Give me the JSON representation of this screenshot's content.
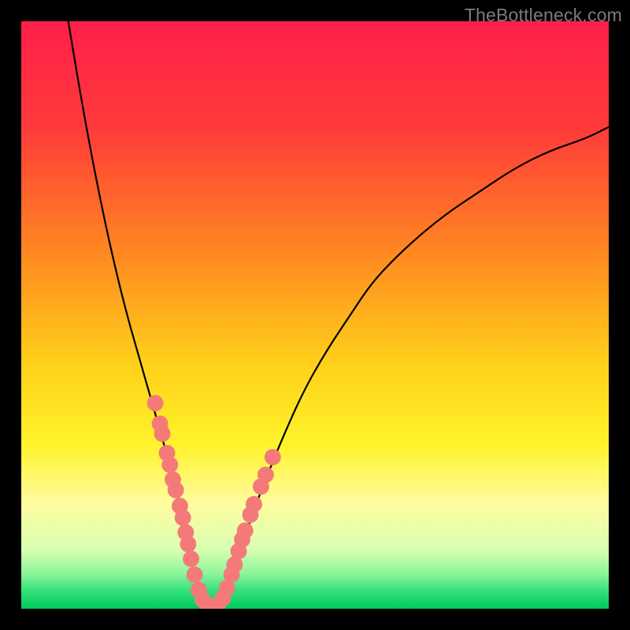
{
  "watermark": "TheBottleneck.com",
  "chart_data": {
    "type": "line",
    "title": "",
    "xlabel": "",
    "ylabel": "",
    "xlim": [
      0,
      100
    ],
    "ylim": [
      0,
      100
    ],
    "grid": false,
    "gradient_stops": [
      {
        "offset": 0.0,
        "color": "#ff1f4a"
      },
      {
        "offset": 0.18,
        "color": "#ff3a3a"
      },
      {
        "offset": 0.4,
        "color": "#ff8a20"
      },
      {
        "offset": 0.58,
        "color": "#ffcf1a"
      },
      {
        "offset": 0.72,
        "color": "#fff32a"
      },
      {
        "offset": 0.82,
        "color": "#fffca0"
      },
      {
        "offset": 0.9,
        "color": "#d9ffb0"
      },
      {
        "offset": 0.94,
        "color": "#8cf59a"
      },
      {
        "offset": 0.97,
        "color": "#33e07a"
      },
      {
        "offset": 1.0,
        "color": "#00c95a"
      }
    ],
    "series": [
      {
        "name": "left-branch",
        "x": [
          8,
          10,
          12,
          14,
          16,
          18,
          20,
          22,
          24,
          26,
          27,
          28,
          29,
          30,
          31
        ],
        "y": [
          100,
          88,
          77,
          67,
          58,
          50,
          43,
          36,
          29,
          22,
          17,
          12,
          8,
          4,
          1
        ]
      },
      {
        "name": "right-branch",
        "x": [
          34,
          36,
          38,
          40,
          44,
          48,
          52,
          56,
          60,
          66,
          72,
          78,
          84,
          90,
          96,
          100
        ],
        "y": [
          1,
          6,
          12,
          18,
          28,
          37,
          44,
          50,
          56,
          62,
          67,
          71,
          75,
          78,
          80,
          82
        ]
      }
    ],
    "trough_beads": {
      "color": "#f47a7a",
      "radius": 1.4,
      "points": [
        {
          "x": 22.8,
          "y": 35.0
        },
        {
          "x": 23.6,
          "y": 31.5
        },
        {
          "x": 24.0,
          "y": 29.8
        },
        {
          "x": 24.8,
          "y": 26.5
        },
        {
          "x": 25.3,
          "y": 24.5
        },
        {
          "x": 25.8,
          "y": 22.0
        },
        {
          "x": 26.3,
          "y": 20.2
        },
        {
          "x": 27.0,
          "y": 17.5
        },
        {
          "x": 27.5,
          "y": 15.5
        },
        {
          "x": 28.0,
          "y": 13.0
        },
        {
          "x": 28.4,
          "y": 11.0
        },
        {
          "x": 28.9,
          "y": 8.5
        },
        {
          "x": 29.5,
          "y": 5.8
        },
        {
          "x": 30.2,
          "y": 3.2
        },
        {
          "x": 30.9,
          "y": 1.5
        },
        {
          "x": 31.8,
          "y": 0.6
        },
        {
          "x": 32.6,
          "y": 0.4
        },
        {
          "x": 33.4,
          "y": 0.6
        },
        {
          "x": 34.3,
          "y": 1.8
        },
        {
          "x": 35.0,
          "y": 3.5
        },
        {
          "x": 35.8,
          "y": 5.8
        },
        {
          "x": 36.3,
          "y": 7.5
        },
        {
          "x": 37.0,
          "y": 9.8
        },
        {
          "x": 37.6,
          "y": 11.8
        },
        {
          "x": 38.1,
          "y": 13.3
        },
        {
          "x": 39.0,
          "y": 16.0
        },
        {
          "x": 39.6,
          "y": 17.8
        },
        {
          "x": 40.8,
          "y": 20.8
        },
        {
          "x": 41.6,
          "y": 22.8
        },
        {
          "x": 42.8,
          "y": 25.8
        }
      ]
    }
  }
}
